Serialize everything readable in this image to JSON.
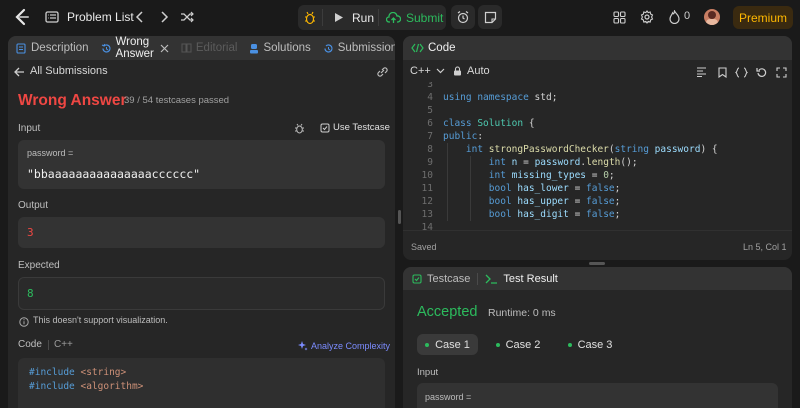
{
  "topbar": {
    "problem_list": "Problem List",
    "run": "Run",
    "submit": "Submit",
    "fire_count": "0",
    "premium": "Premium"
  },
  "left": {
    "tabs": [
      "Description",
      "Wrong Answer",
      "Editorial",
      "Solutions",
      "Submissions"
    ],
    "back_label": "All Submissions",
    "verdict": "Wrong Answer",
    "testcases": "39 / 54 testcases passed",
    "input_label": "Input",
    "use_testcase": "Use Testcase",
    "param_name": "password =",
    "param_value": "\"bbaaaaaaaaaaaaaaacccccc\"",
    "output_label": "Output",
    "output_value": "3",
    "expected_label": "Expected",
    "expected_value": "8",
    "no_visual": "This doesn't support visualization.",
    "code_label": "Code",
    "code_lang": "C++",
    "analyze": "Analyze Complexity",
    "code_lines": [
      "#include <string>",
      "#include <algorithm>"
    ]
  },
  "editor": {
    "title": "Code",
    "lang": "C++",
    "mode": "Auto",
    "saved": "Saved",
    "cursor": "Ln 5, Col 1",
    "lines": [
      {
        "n": "3",
        "tokens": []
      },
      {
        "n": "4",
        "tokens": [
          [
            "k",
            "using "
          ],
          [
            "k",
            "namespace "
          ],
          [
            "p",
            "std;"
          ]
        ]
      },
      {
        "n": "5",
        "tokens": []
      },
      {
        "n": "6",
        "tokens": [
          [
            "k",
            "class "
          ],
          [
            "t",
            "Solution "
          ],
          [
            "p",
            "{"
          ]
        ]
      },
      {
        "n": "7",
        "tokens": [
          [
            "k",
            "public"
          ],
          [
            "p",
            ":"
          ]
        ]
      },
      {
        "n": "8",
        "tokens": [
          [
            "p",
            "    "
          ],
          [
            "k",
            "int "
          ],
          [
            "f",
            "strongPasswordChecker"
          ],
          [
            "p",
            "("
          ],
          [
            "k",
            "string "
          ],
          [
            "v",
            "password"
          ],
          [
            "p",
            ") {"
          ]
        ]
      },
      {
        "n": "9",
        "tokens": [
          [
            "p",
            "        "
          ],
          [
            "k",
            "int "
          ],
          [
            "v",
            "n"
          ],
          [
            "p",
            " = "
          ],
          [
            "v",
            "password"
          ],
          [
            "p",
            "."
          ],
          [
            "f",
            "length"
          ],
          [
            "p",
            "();"
          ]
        ]
      },
      {
        "n": "10",
        "tokens": [
          [
            "p",
            "        "
          ],
          [
            "k",
            "int "
          ],
          [
            "v",
            "missing_types"
          ],
          [
            "p",
            " = "
          ],
          [
            "n",
            "0"
          ],
          [
            "p",
            ";"
          ]
        ]
      },
      {
        "n": "11",
        "tokens": [
          [
            "p",
            "        "
          ],
          [
            "k",
            "bool "
          ],
          [
            "v",
            "has_lower"
          ],
          [
            "p",
            " = "
          ],
          [
            "k",
            "false"
          ],
          [
            "p",
            ";"
          ]
        ]
      },
      {
        "n": "12",
        "tokens": [
          [
            "p",
            "        "
          ],
          [
            "k",
            "bool "
          ],
          [
            "v",
            "has_upper"
          ],
          [
            "p",
            " = "
          ],
          [
            "k",
            "false"
          ],
          [
            "p",
            ";"
          ]
        ]
      },
      {
        "n": "13",
        "tokens": [
          [
            "p",
            "        "
          ],
          [
            "k",
            "bool "
          ],
          [
            "v",
            "has_digit"
          ],
          [
            "p",
            " = "
          ],
          [
            "k",
            "false"
          ],
          [
            "p",
            ";"
          ]
        ]
      },
      {
        "n": "14",
        "tokens": []
      }
    ]
  },
  "result": {
    "tab_testcase": "Testcase",
    "tab_result": "Test Result",
    "status": "Accepted",
    "runtime": "Runtime: 0 ms",
    "cases": [
      "Case 1",
      "Case 2",
      "Case 3"
    ],
    "input_label": "Input",
    "param_name": "password ="
  },
  "colors": {
    "accent_green": "#2cbb5d",
    "error_red": "#ef4743",
    "premium_gold": "#ffb800",
    "analyze_purple": "#7c8cff"
  }
}
